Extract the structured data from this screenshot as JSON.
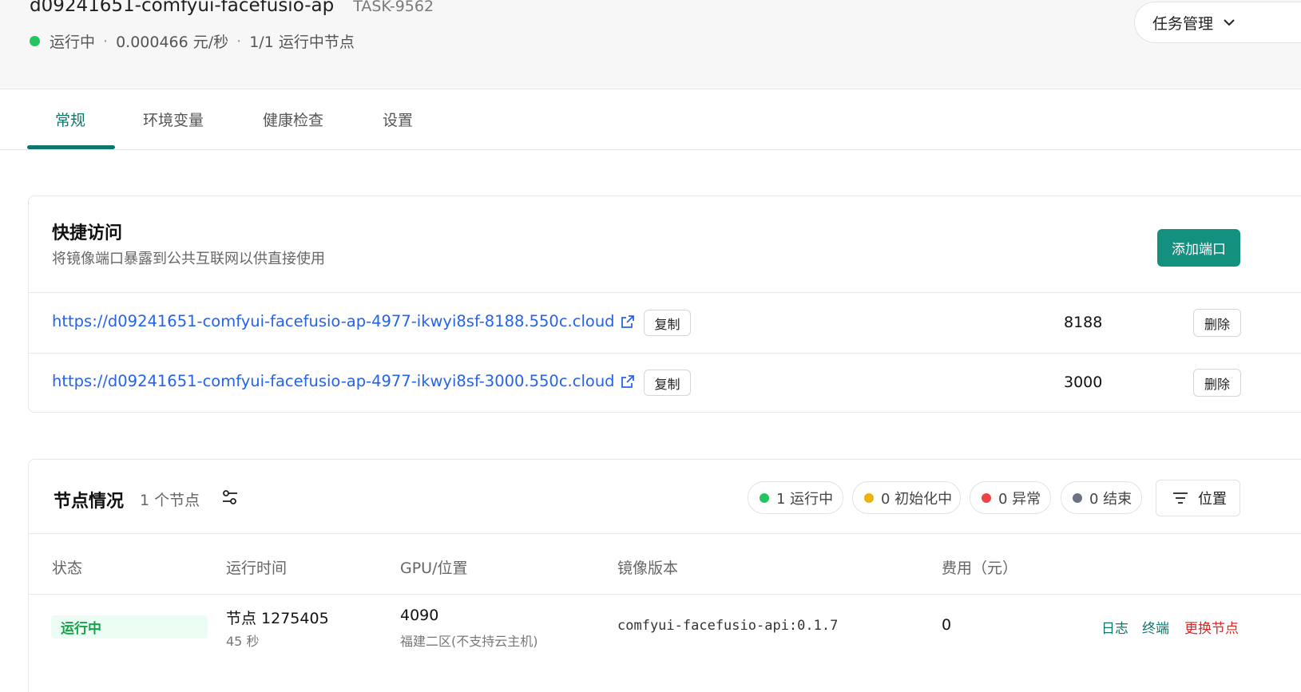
{
  "header": {
    "title": "d09241651-comfyui-facefusio-ap",
    "task_id": "TASK-9562",
    "status": "运行中",
    "rate": "0.000466 元/秒",
    "nodes_running": "1/1 运行中节点",
    "separator": "·",
    "task_mgmt_label": "任务管理",
    "status_color": "#22c55e"
  },
  "tabs": [
    {
      "label": "常规",
      "active": true
    },
    {
      "label": "环境变量",
      "active": false
    },
    {
      "label": "健康检查",
      "active": false
    },
    {
      "label": "设置",
      "active": false
    }
  ],
  "quick_access": {
    "title": "快捷访问",
    "subtitle": "将镜像端口暴露到公共互联网以供直接使用",
    "add_port_label": "添加端口",
    "links": [
      {
        "url": "https://d09241651-comfyui-facefusio-ap-4977-ikwyi8sf-8188.550c.cloud",
        "copy_label": "复制",
        "port": "8188",
        "delete_label": "删除"
      },
      {
        "url": "https://d09241651-comfyui-facefusio-ap-4977-ikwyi8sf-3000.550c.cloud",
        "copy_label": "复制",
        "port": "3000",
        "delete_label": "删除"
      }
    ]
  },
  "nodes": {
    "title": "节点情况",
    "count": "1 个节点",
    "pills": [
      {
        "label": "1 运行中",
        "color": "#22c55e"
      },
      {
        "label": "0 初始化中",
        "color": "#eab308"
      },
      {
        "label": "0 异常",
        "color": "#ef4444"
      },
      {
        "label": "0 结束",
        "color": "#6b7280"
      }
    ],
    "location_label": "位置",
    "columns": [
      "状态",
      "运行时间",
      "GPU/位置",
      "镜像版本",
      "费用（元）"
    ],
    "rows": [
      {
        "status": "运行中",
        "node": "节点 1275405",
        "runtime": "45 秒",
        "gpu": "4090",
        "location": "福建二区(不支持云主机)",
        "image": "comfyui-facefusio-api:0.1.7",
        "cost": "0",
        "actions": [
          {
            "label": "日志",
            "color": "#0f766e"
          },
          {
            "label": "终端",
            "color": "#0f766e"
          },
          {
            "label": "更换节点",
            "color": "#dc2626"
          }
        ]
      }
    ]
  },
  "colors": {
    "accent": "#0f766e",
    "primary_button": "#14907f",
    "link": "#2563eb"
  }
}
